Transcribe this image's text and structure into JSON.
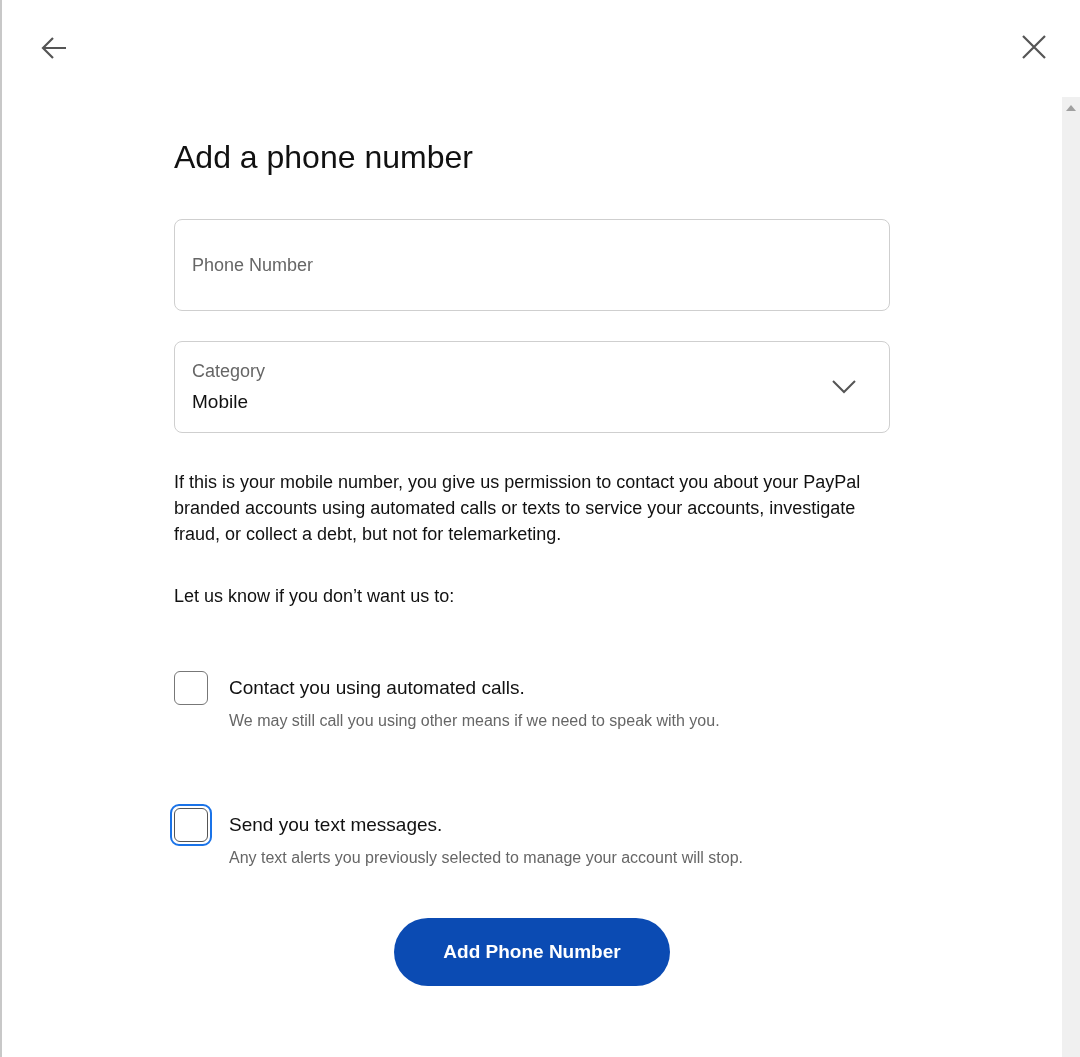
{
  "title": "Add a phone number",
  "phone_field": {
    "placeholder": "Phone Number"
  },
  "category_select": {
    "label": "Category",
    "value": "Mobile"
  },
  "consent_text": "If this is your mobile number, you give us permission to contact you about your PayPal branded accounts using automated calls or texts to service your accounts, investigate fraud, or collect a debt, but not for telemarketing.",
  "opt_out_heading": "Let us know if you don’t want us to:",
  "options": [
    {
      "label": "Contact you using automated calls.",
      "hint": "We may still call you using other means if we need to speak with you.",
      "checked": false,
      "focused": false
    },
    {
      "label": "Send you text messages.",
      "hint": "Any text alerts you previously selected to manage your account will stop.",
      "checked": false,
      "focused": true
    }
  ],
  "submit_button": "Add Phone Number"
}
